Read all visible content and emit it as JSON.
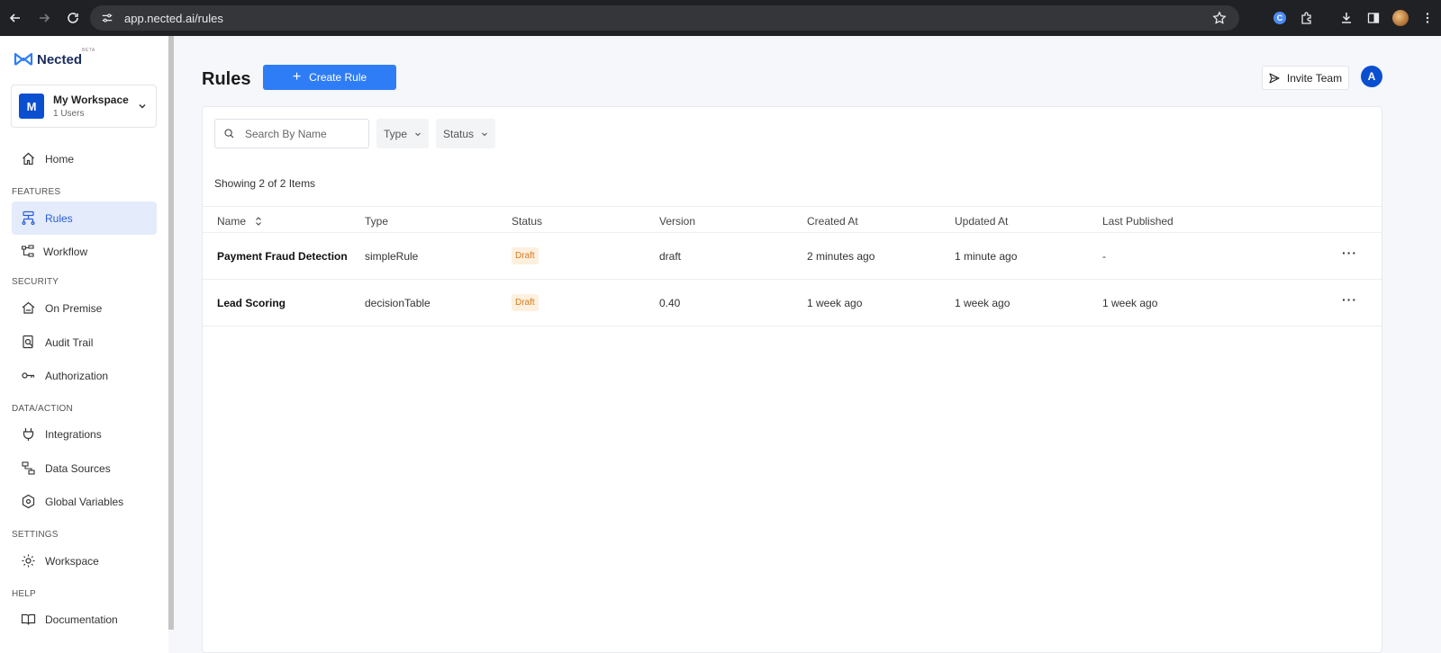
{
  "browser": {
    "url": "app.nected.ai/rules"
  },
  "brand": {
    "name": "Nected",
    "tag": "BETA",
    "accent": "#2f7df6"
  },
  "workspace": {
    "initial": "M",
    "name": "My Workspace",
    "users": "1 Users"
  },
  "sidebar": {
    "home": "Home",
    "sections": {
      "features": "FEATURES",
      "security": "SECURITY",
      "data_action": "DATA/ACTION",
      "settings": "SETTINGS",
      "help": "HELP"
    },
    "items": {
      "rules": "Rules",
      "workflow": "Workflow",
      "on_premise": "On Premise",
      "audit_trail": "Audit Trail",
      "authorization": "Authorization",
      "integrations": "Integrations",
      "data_sources": "Data Sources",
      "global_variables": "Global Variables",
      "workspace": "Workspace",
      "documentation": "Documentation"
    }
  },
  "header": {
    "title": "Rules",
    "create_label": "Create Rule",
    "invite_label": "Invite Team",
    "user_initial": "A"
  },
  "filters": {
    "search_placeholder": "Search By Name",
    "type_label": "Type",
    "status_label": "Status"
  },
  "list": {
    "showing": "Showing 2 of 2 Items",
    "columns": {
      "name": "Name",
      "type": "Type",
      "status": "Status",
      "version": "Version",
      "created_at": "Created At",
      "updated_at": "Updated At",
      "last_published": "Last Published"
    },
    "rows": [
      {
        "name": "Payment Fraud Detection",
        "type": "simpleRule",
        "status": "Draft",
        "version": "draft",
        "created_at": "2 minutes ago",
        "updated_at": "1 minute ago",
        "last_published": "-",
        "more": "···"
      },
      {
        "name": "Lead Scoring",
        "type": "decisionTable",
        "status": "Draft",
        "version": "0.40",
        "created_at": "1 week ago",
        "updated_at": "1 week ago",
        "last_published": "1 week ago",
        "more": "···"
      }
    ]
  }
}
